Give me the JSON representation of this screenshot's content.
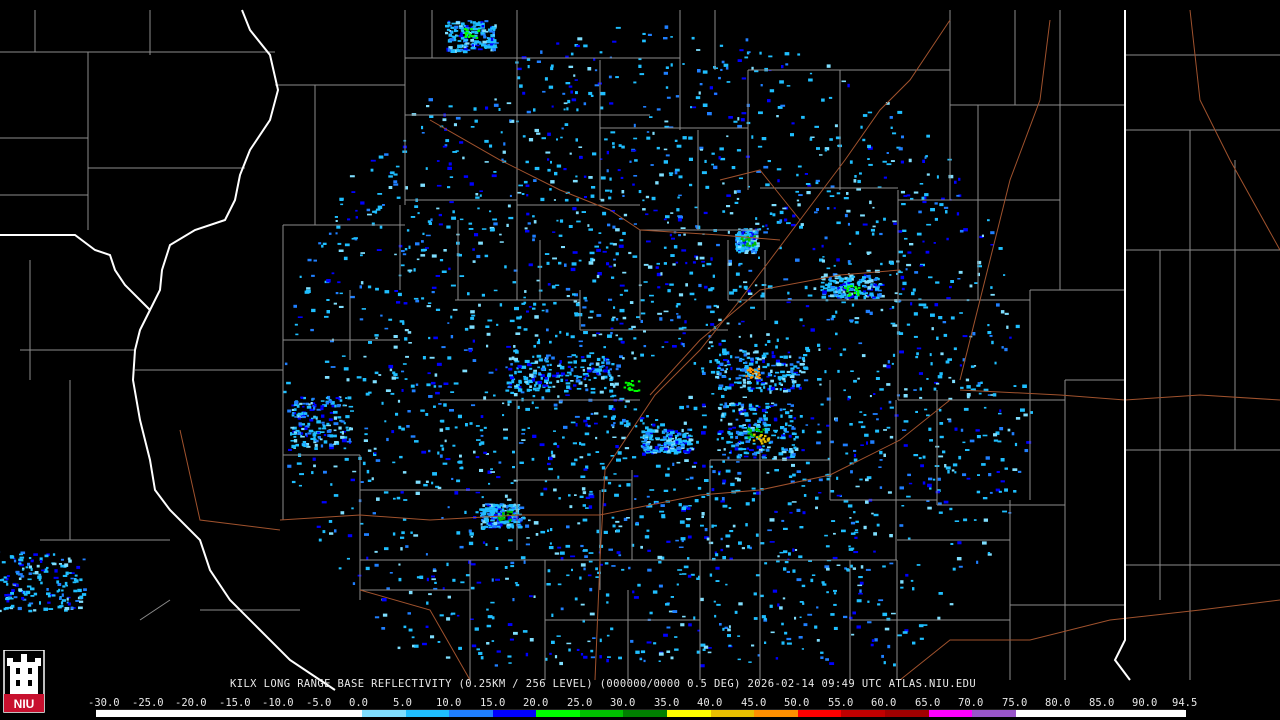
{
  "product": {
    "caption": "KILX LONG RANGE BASE REFLECTIVITY (0.25KM / 256 LEVEL) (000000/0000 0.5 DEG) 2026-02-14 09:49 UTC  ATLAS.NIU.EDU"
  },
  "logo": {
    "text": "NIU",
    "accent_color": "#c8102e"
  },
  "colors": {
    "background": "#000000",
    "county_lines": "#8c8c8c",
    "state_lines": "#ffffff",
    "highways": "#a0522d"
  },
  "scale": {
    "labels": [
      "-30.0",
      "-25.0",
      "-20.0",
      "-15.0",
      "-10.0",
      "-5.0",
      "0.0",
      "5.0",
      "10.0",
      "15.0",
      "20.0",
      "25.0",
      "30.0",
      "35.0",
      "40.0",
      "45.0",
      "50.0",
      "55.0",
      "60.0",
      "65.0",
      "70.0",
      "75.0",
      "80.0",
      "85.0",
      "90.0",
      "94.5"
    ],
    "stops": [
      {
        "dbz": -30,
        "color": "#ffffff"
      },
      {
        "dbz": -5,
        "color": "#ffffff"
      },
      {
        "dbz": 0,
        "color": "#7fdfff"
      },
      {
        "dbz": 5,
        "color": "#1fbfff"
      },
      {
        "dbz": 10,
        "color": "#1f7fff"
      },
      {
        "dbz": 15,
        "color": "#0000ff"
      },
      {
        "dbz": 20,
        "color": "#00ff00"
      },
      {
        "dbz": 25,
        "color": "#00c000"
      },
      {
        "dbz": 30,
        "color": "#008000"
      },
      {
        "dbz": 35,
        "color": "#ffff00"
      },
      {
        "dbz": 40,
        "color": "#e8c000"
      },
      {
        "dbz": 45,
        "color": "#ff9000"
      },
      {
        "dbz": 50,
        "color": "#ff0000"
      },
      {
        "dbz": 55,
        "color": "#c00000"
      },
      {
        "dbz": 60,
        "color": "#a00000"
      },
      {
        "dbz": 65,
        "color": "#ff00ff"
      },
      {
        "dbz": 70,
        "color": "#9955c9"
      },
      {
        "dbz": 75,
        "color": "#ffffff"
      },
      {
        "dbz": 94.5,
        "color": "#ffffff"
      }
    ]
  }
}
